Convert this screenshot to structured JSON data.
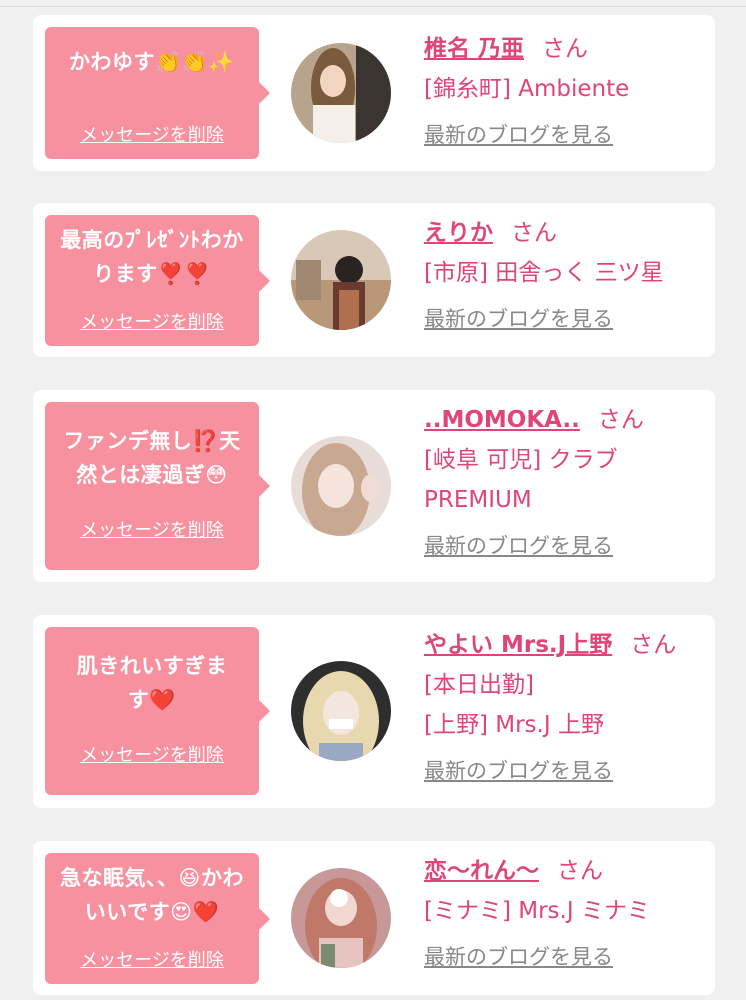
{
  "cards": [
    {
      "message": "かわゆす👏👏✨",
      "delete_label": "メッセージを削除",
      "name": "椎名 乃亜",
      "suffix": "さん",
      "shop": "[錦糸町] Ambiente",
      "blog_label": "最新のブログを見る"
    },
    {
      "message": "最高のﾌﾟﾚｾﾞﾝﾄわかります❣️❣️",
      "delete_label": "メッセージを削除",
      "name": "えりか",
      "suffix": "さん",
      "shop": "[市原] 田舎っく 三ツ星",
      "blog_label": "最新のブログを見る"
    },
    {
      "message": "ファンデ無し⁉️天然とは凄過ぎ😳",
      "delete_label": "メッセージを削除",
      "name": "..MOMOKA..",
      "suffix": "さん",
      "shop": "[岐阜 可児] クラブ PREMIUM",
      "blog_label": "最新のブログを見る"
    },
    {
      "message": "肌きれいすぎます❤️",
      "delete_label": "メッセージを削除",
      "name": "やよい Mrs.J上野",
      "suffix": "さん[本日出勤]",
      "shop": "[上野] Mrs.J 上野",
      "blog_label": "最新のブログを見る"
    },
    {
      "message": "急な眠気、、😆かわいいです😍❤️",
      "delete_label": "メッセージを削除",
      "name": "恋〜れん〜",
      "suffix": "さん",
      "shop": "[ミナミ] Mrs.J ミナミ",
      "blog_label": "最新のブログを見る"
    }
  ],
  "colors": {
    "bubble": "#f7919f",
    "accent": "#e0447a",
    "link_gray": "#888888",
    "background": "#f0f0f0"
  }
}
